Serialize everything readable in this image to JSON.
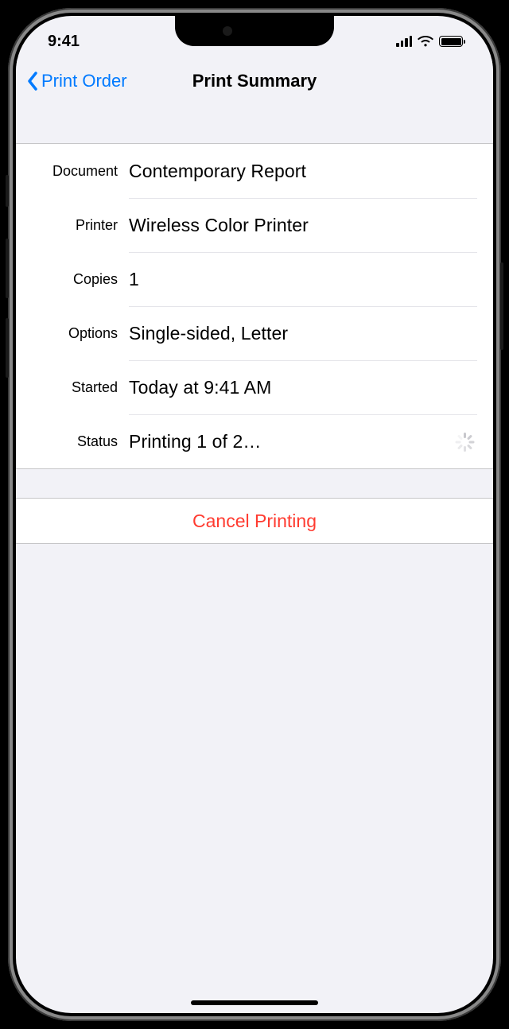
{
  "status_bar": {
    "time": "9:41"
  },
  "nav": {
    "back_label": "Print Order",
    "title": "Print Summary"
  },
  "details": {
    "document": {
      "label": "Document",
      "value": "Contemporary Report"
    },
    "printer": {
      "label": "Printer",
      "value": "Wireless Color Printer"
    },
    "copies": {
      "label": "Copies",
      "value": "1"
    },
    "options": {
      "label": "Options",
      "value": "Single-sided, Letter"
    },
    "started": {
      "label": "Started",
      "value": "Today at  9:41 AM"
    },
    "status": {
      "label": "Status",
      "value": "Printing 1 of 2…"
    }
  },
  "actions": {
    "cancel_label": "Cancel Printing"
  },
  "colors": {
    "tint": "#007aff",
    "destructive": "#ff3b30",
    "background": "#f2f2f7"
  }
}
